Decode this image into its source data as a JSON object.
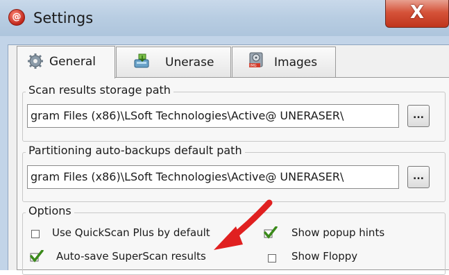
{
  "window": {
    "title": "Settings",
    "close_symbol": "X"
  },
  "tabs": [
    {
      "label": "General",
      "icon": "gear-icon",
      "active": true
    },
    {
      "label": "Unerase",
      "icon": "unerase-icon",
      "active": false
    },
    {
      "label": "Images",
      "icon": "disk-image-icon",
      "active": false
    }
  ],
  "scan_path": {
    "label": "Scan results storage path",
    "value": "gram Files (x86)\\LSoft Technologies\\Active@ UNERASER\\",
    "browse_label": "..."
  },
  "backup_path": {
    "label": "Partitioning auto-backups default path",
    "value": "gram Files (x86)\\LSoft Technologies\\Active@ UNERASER\\",
    "browse_label": "..."
  },
  "options": {
    "label": "Options",
    "items": [
      {
        "label": "Use QuickScan Plus by default",
        "checked": false
      },
      {
        "label": "Show popup hints",
        "checked": true
      },
      {
        "label": "Auto-save SuperScan results",
        "checked": true
      },
      {
        "label": "Show Floppy",
        "checked": false
      }
    ]
  },
  "colors": {
    "annotation_arrow": "#e02020",
    "check_green": "#3a8a1a",
    "close_button": "#c8432a"
  }
}
